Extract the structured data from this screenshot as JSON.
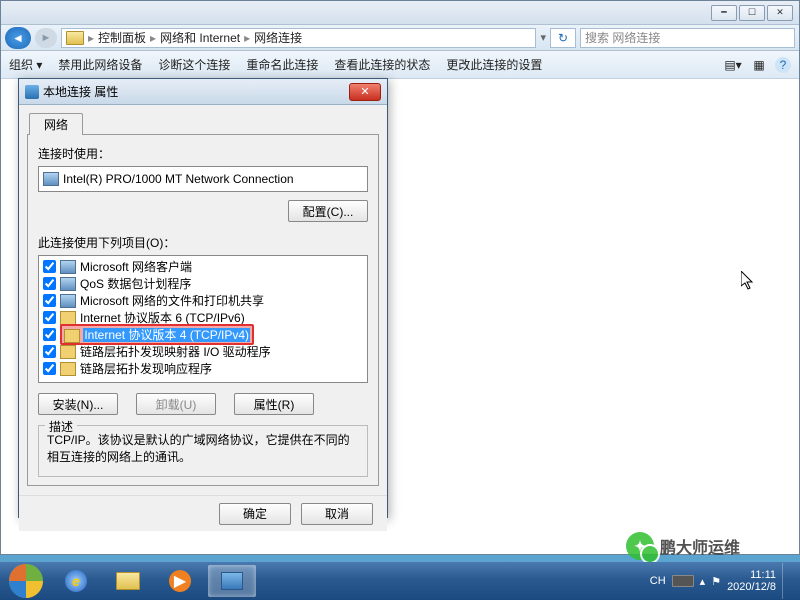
{
  "titlebar_buttons": {
    "min": "━",
    "max": "☐",
    "close": "✕"
  },
  "breadcrumb": {
    "root_icon": "🖥",
    "parts": [
      "控制面板",
      "网络和 Internet",
      "网络连接"
    ]
  },
  "nav": {
    "refresh": "↻"
  },
  "search": {
    "placeholder": "搜索 网络连接"
  },
  "toolbar": {
    "organize": "组织 ▾",
    "disable": "禁用此网络设备",
    "diagnose": "诊断这个连接",
    "rename": "重命名此连接",
    "status": "查看此连接的状态",
    "change": "更改此连接的设置",
    "views": "▤▾",
    "details": "▦",
    "help": "?"
  },
  "dialog": {
    "title": "本地连接 属性",
    "tab": "网络",
    "connect_using": "连接时使用：",
    "adapter": "Intel(R) PRO/1000 MT Network Connection",
    "configure": "配置(C)...",
    "items_label": "此连接使用下列项目(O)：",
    "items": [
      "Microsoft 网络客户端",
      "QoS 数据包计划程序",
      "Microsoft 网络的文件和打印机共享",
      "Internet 协议版本 6 (TCP/IPv6)",
      "Internet 协议版本 4 (TCP/IPv4)",
      "链路层拓扑发现映射器 I/O 驱动程序",
      "链路层拓扑发现响应程序"
    ],
    "install": "安装(N)...",
    "uninstall": "卸载(U)",
    "properties": "属性(R)",
    "desc_legend": "描述",
    "desc_text": "TCP/IP。该协议是默认的广域网络协议，它提供在不同的相互连接的网络上的通讯。",
    "ok": "确定",
    "cancel": "取消"
  },
  "tray": {
    "lang": "CH",
    "time": "11:11",
    "date": "2020/12/8"
  },
  "watermark": "鹏大师运维"
}
